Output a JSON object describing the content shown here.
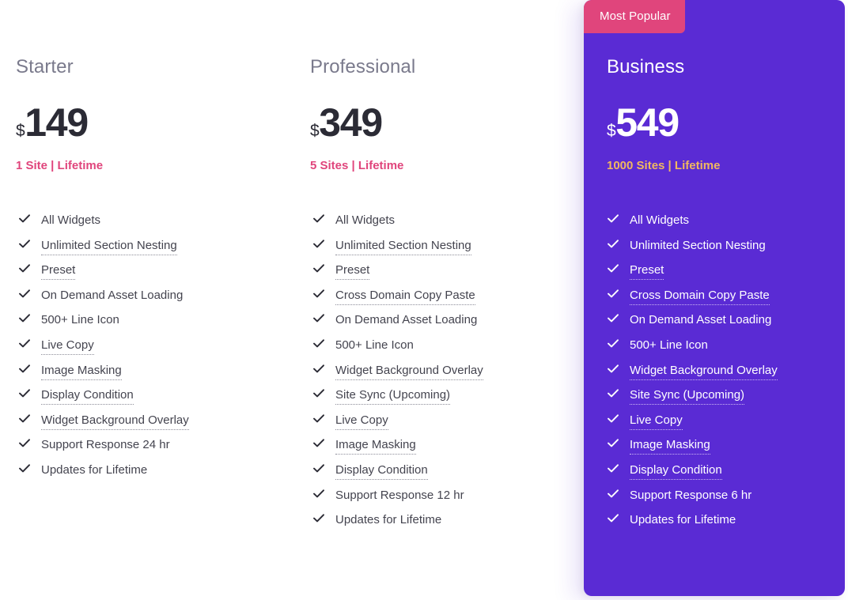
{
  "plans": [
    {
      "id": "starter",
      "name": "Starter",
      "currency": "$",
      "price": "149",
      "subtitle": "1 Site | Lifetime",
      "featured": false,
      "features": [
        {
          "label": "All Widgets",
          "tooltip": false
        },
        {
          "label": "Unlimited Section Nesting",
          "tooltip": true
        },
        {
          "label": "Preset",
          "tooltip": true
        },
        {
          "label": "On Demand Asset Loading",
          "tooltip": false
        },
        {
          "label": "500+ Line Icon",
          "tooltip": false
        },
        {
          "label": "Live Copy",
          "tooltip": true
        },
        {
          "label": "Image Masking",
          "tooltip": true
        },
        {
          "label": "Display Condition",
          "tooltip": true
        },
        {
          "label": "Widget Background Overlay",
          "tooltip": true
        },
        {
          "label": "Support Response 24 hr",
          "tooltip": false
        },
        {
          "label": "Updates for Lifetime",
          "tooltip": false
        }
      ]
    },
    {
      "id": "professional",
      "name": "Professional",
      "currency": "$",
      "price": "349",
      "subtitle": "5 Sites | Lifetime",
      "featured": false,
      "features": [
        {
          "label": "All Widgets",
          "tooltip": false
        },
        {
          "label": "Unlimited Section Nesting",
          "tooltip": true
        },
        {
          "label": "Preset",
          "tooltip": true
        },
        {
          "label": "Cross Domain Copy Paste",
          "tooltip": true
        },
        {
          "label": "On Demand Asset Loading",
          "tooltip": false
        },
        {
          "label": "500+ Line Icon",
          "tooltip": false
        },
        {
          "label": "Widget Background Overlay",
          "tooltip": true
        },
        {
          "label": "Site Sync (Upcoming)",
          "tooltip": true
        },
        {
          "label": "Live Copy",
          "tooltip": true
        },
        {
          "label": "Image Masking",
          "tooltip": true
        },
        {
          "label": "Display Condition",
          "tooltip": true
        },
        {
          "label": "Support Response 12 hr",
          "tooltip": false
        },
        {
          "label": "Updates for Lifetime",
          "tooltip": false
        }
      ]
    },
    {
      "id": "business",
      "name": "Business",
      "currency": "$",
      "price": "549",
      "subtitle": "1000 Sites | Lifetime",
      "featured": true,
      "badge": "Most Popular",
      "features": [
        {
          "label": "All Widgets",
          "tooltip": false
        },
        {
          "label": "Unlimited Section Nesting",
          "tooltip": false
        },
        {
          "label": "Preset",
          "tooltip": true
        },
        {
          "label": "Cross Domain Copy Paste",
          "tooltip": true
        },
        {
          "label": "On Demand Asset Loading",
          "tooltip": false
        },
        {
          "label": "500+ Line Icon",
          "tooltip": false
        },
        {
          "label": "Widget Background Overlay",
          "tooltip": true
        },
        {
          "label": "Site Sync (Upcoming)",
          "tooltip": true
        },
        {
          "label": "Live Copy",
          "tooltip": true
        },
        {
          "label": "Image Masking",
          "tooltip": true
        },
        {
          "label": "Display Condition",
          "tooltip": true
        },
        {
          "label": "Support Response 6 hr",
          "tooltip": false
        },
        {
          "label": "Updates for Lifetime",
          "tooltip": false
        }
      ]
    }
  ],
  "icons": {
    "check": "check-icon"
  },
  "colors": {
    "featured_bg": "#5A2BD4",
    "badge_bg": "#E0457C",
    "subtitle_pink": "#E0457C",
    "subtitle_gold": "#F0B860",
    "heading": "#7A7A8C",
    "price": "#2B2B35",
    "feature_text": "#44444F",
    "featured_text": "#FFFFFF"
  }
}
